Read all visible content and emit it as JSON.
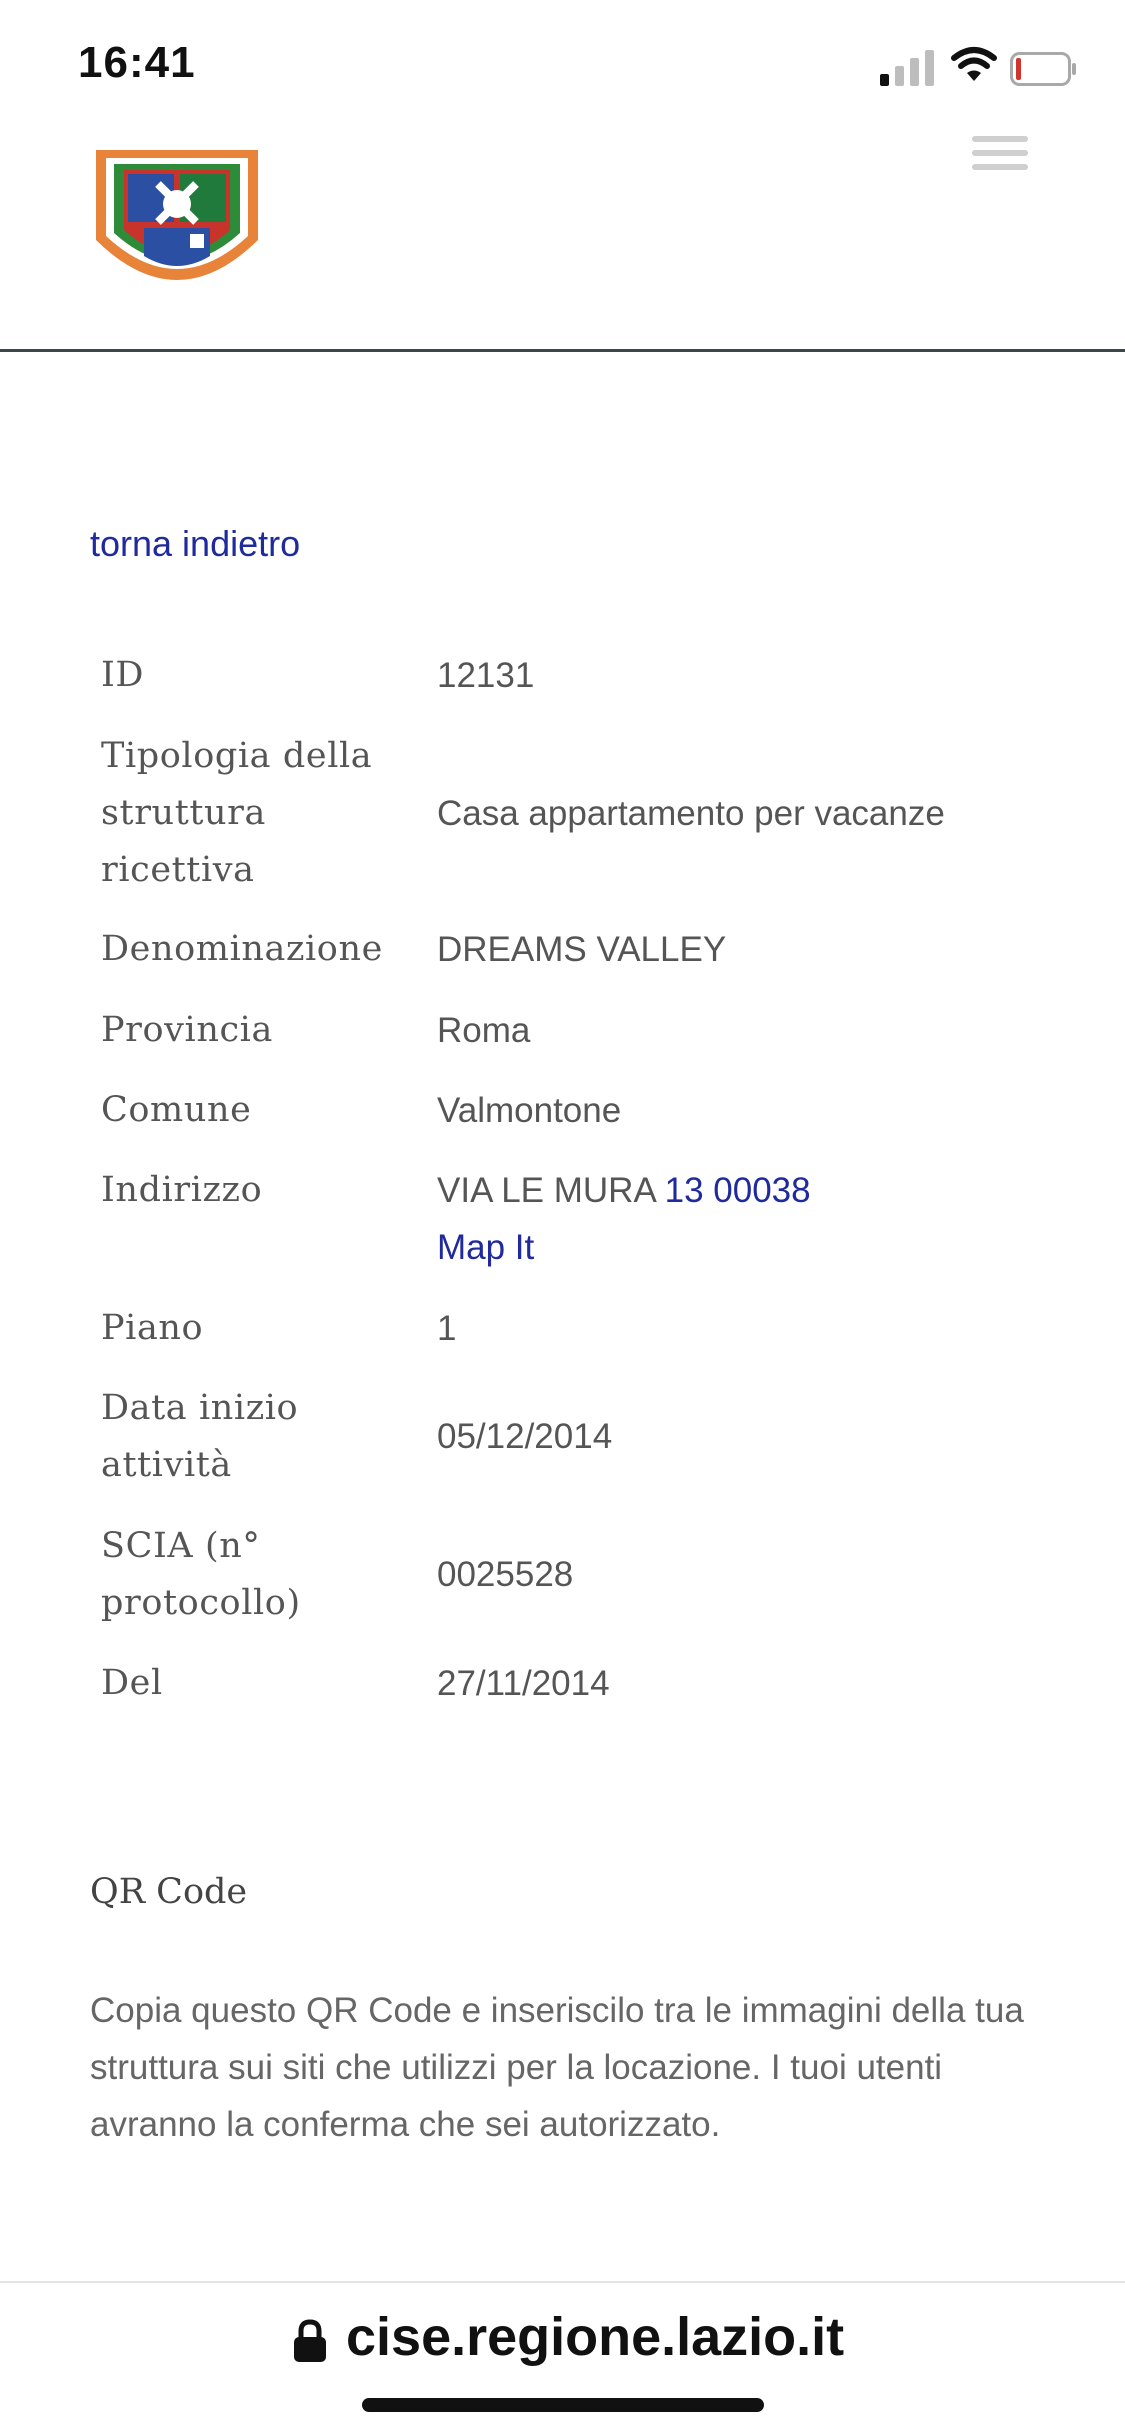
{
  "status_bar": {
    "time": "16:41",
    "battery_level": 0.08,
    "battery_color": "#d0352d"
  },
  "header": {
    "logo_icon": "regione-lazio-coat-of-arms",
    "menu_icon": "hamburger-menu-icon"
  },
  "back_link": "torna indietro",
  "details": [
    {
      "label": "ID",
      "value": "12131"
    },
    {
      "label": "Tipologia della struttura ricettiva",
      "value": "Casa appartamento per vacanze"
    },
    {
      "label": "Denominazione",
      "value": "DREAMS VALLEY"
    },
    {
      "label": "Provincia",
      "value": "Roma"
    },
    {
      "label": "Comune",
      "value": "Valmontone"
    },
    {
      "label": "Indirizzo",
      "value_street": "VIA LE MURA",
      "value_number": "13 00038",
      "map_link": "Map It"
    },
    {
      "label": "Piano",
      "value": "1"
    },
    {
      "label": "Data inizio attività",
      "value": "05/12/2014"
    },
    {
      "label": "SCIA (n° protocollo)",
      "value": "0025528"
    },
    {
      "label": "Del",
      "value": "27/11/2014"
    }
  ],
  "qr": {
    "title": "QR Code",
    "text": "Copia questo QR Code e inseriscilo tra le immagini della tua struttura sui siti che utilizzi per la locazione. I tuoi utenti avranno la conferma che sei autorizzato."
  },
  "browser": {
    "url": "cise.regione.lazio.it"
  },
  "colors": {
    "link": "#1f2a9c",
    "header_rule": "#3b474a"
  }
}
